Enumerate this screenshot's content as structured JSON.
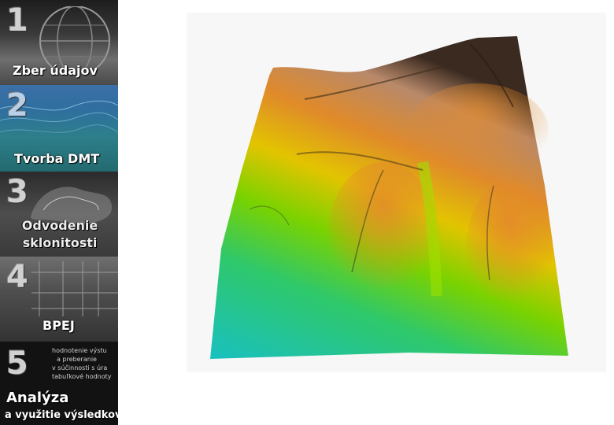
{
  "steps": [
    {
      "number": "1",
      "title": "Zber údajov"
    },
    {
      "number": "2",
      "title": "Tvorba DMT"
    },
    {
      "number": "3",
      "title": "Odvodenie sklonitosti"
    },
    {
      "number": "4",
      "title": "BPEJ"
    },
    {
      "number": "5",
      "title": "Analýza",
      "subtitle": "a využitie výsledkov",
      "description": [
        "hodnotenie výstu",
        "a preberanie",
        "v súčinnosti s úra",
        "tabuľkové hodnoty"
      ]
    }
  ],
  "viewport": {
    "image": "terrain-3d-model",
    "colors": {
      "low": "#19c0c0",
      "mid": "#7ad200",
      "high": "#e08a2a",
      "peak": "#3a2a20"
    }
  }
}
